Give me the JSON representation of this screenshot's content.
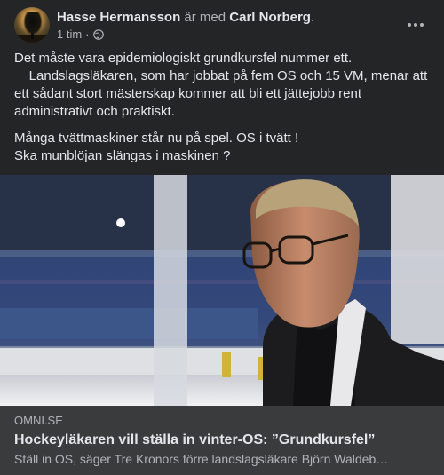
{
  "post": {
    "author": "Hasse Hermansson",
    "with_text": "är med",
    "tagged": "Carl Norberg",
    "tagged_suffix": ".",
    "time": "1 tim",
    "time_sep": "·",
    "audience_icon": "globe-icon",
    "more_icon": "more-options-icon",
    "paragraphs": [
      "Det måste vara epidemiologiskt grundkursfel nummer ett.",
      "    Landslagsläkaren, som har jobbat på fem OS och 15 VM, menar att ett sådant stort mästerskap kommer att bli ett jättejobb rent administrativt och praktiskt.",
      "Många tvättmaskiner står nu på spel. OS i tvätt !",
      "Ska munblöjan slängas i maskinen ?"
    ]
  },
  "link_preview": {
    "domain": "OMNI.SE",
    "title": "Hockeyläkaren vill ställa in vinter-OS: ”Grundkursfel”",
    "description": "Ställ in OS, säger Tre Kronors förre landslagsläkare Björn Waldeb…"
  },
  "colors": {
    "background": "#242526",
    "link_background": "#3a3b3c",
    "primary_text": "#e4e6eb",
    "secondary_text": "#b0b3b8"
  }
}
